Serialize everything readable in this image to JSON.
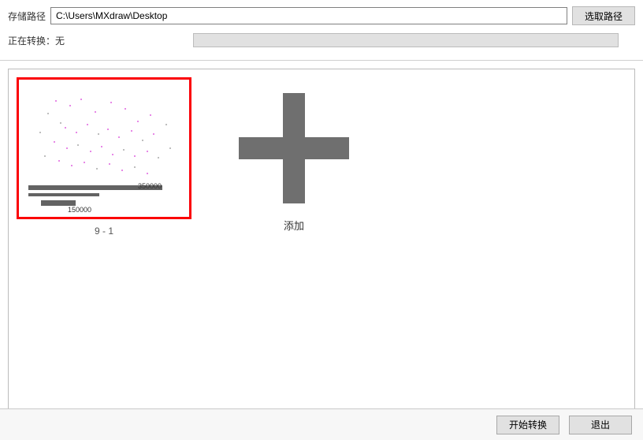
{
  "top": {
    "path_label": "存储路径",
    "path_value": "C:\\Users\\MXdraw\\Desktop",
    "pick_path_btn": "选取路径",
    "status_label": "正在转换：无"
  },
  "items": [
    {
      "caption": "9 - 1",
      "num_label_top": "350000",
      "num_label_bottom": "150000"
    }
  ],
  "add": {
    "caption": "添加"
  },
  "buttons": {
    "start": "开始转换",
    "exit": "退出"
  }
}
